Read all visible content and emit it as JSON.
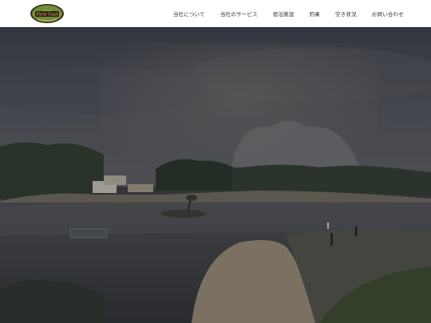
{
  "brand": {
    "logo_text": "First Cast",
    "logo_subtext": "PRIVATE FISHING"
  },
  "nav": {
    "items": [
      {
        "label": "当社について"
      },
      {
        "label": "当社のサービス"
      },
      {
        "label": "宿泊施設"
      },
      {
        "label": "釣果"
      },
      {
        "label": "空き状況"
      },
      {
        "label": "お問い合わせ"
      }
    ]
  },
  "colors": {
    "header_bg": "#ffffff",
    "nav_text": "#333333",
    "hero_overlay": "#2a2c30"
  }
}
